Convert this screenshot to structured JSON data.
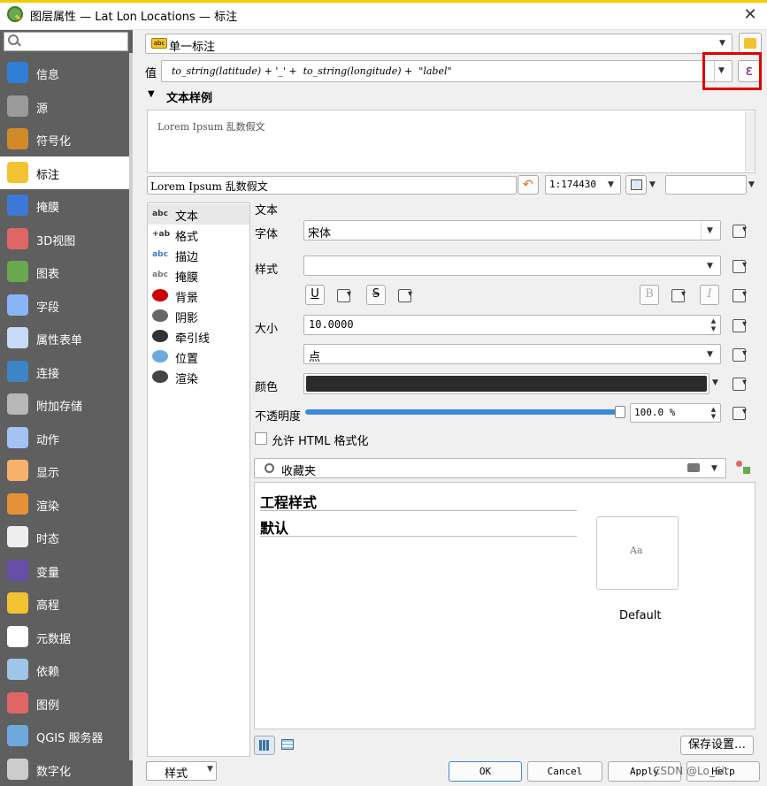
{
  "window": {
    "title": "图层属性 — Lat Lon Locations — 标注",
    "close": "✕"
  },
  "sidebar": {
    "search_placeholder": "",
    "items": [
      {
        "label": "信息",
        "icon": "info-icon",
        "color": "#2f7ed8"
      },
      {
        "label": "源",
        "icon": "source-icon",
        "color": "#9b9b9b"
      },
      {
        "label": "符号化",
        "icon": "symbology-icon",
        "color": "#d08a2a"
      },
      {
        "label": "标注",
        "icon": "labels-icon",
        "color": "#f1c232"
      },
      {
        "label": "掩膜",
        "icon": "mask-icon",
        "color": "#3c78d8"
      },
      {
        "label": "3D视图",
        "icon": "3d-view-icon",
        "color": "#e06666"
      },
      {
        "label": "图表",
        "icon": "diagrams-icon",
        "color": "#6aa84f"
      },
      {
        "label": "字段",
        "icon": "fields-icon",
        "color": "#8ab4f8"
      },
      {
        "label": "属性表单",
        "icon": "attributes-form-icon",
        "color": "#c9daf8"
      },
      {
        "label": "连接",
        "icon": "joins-icon",
        "color": "#3d85c6"
      },
      {
        "label": "附加存储",
        "icon": "auxiliary-storage-icon",
        "color": "#b7b7b7"
      },
      {
        "label": "动作",
        "icon": "actions-icon",
        "color": "#a4c2f4"
      },
      {
        "label": "显示",
        "icon": "display-icon",
        "color": "#f6b26b"
      },
      {
        "label": "渲染",
        "icon": "rendering-icon",
        "color": "#e69138"
      },
      {
        "label": "时态",
        "icon": "temporal-icon",
        "color": "#eeeeee"
      },
      {
        "label": "变量",
        "icon": "variables-icon",
        "color": "#674ea7"
      },
      {
        "label": "高程",
        "icon": "elevation-icon",
        "color": "#f1c232"
      },
      {
        "label": "元数据",
        "icon": "metadata-icon",
        "color": "#ffffff"
      },
      {
        "label": "依赖",
        "icon": "dependencies-icon",
        "color": "#9fc5e8"
      },
      {
        "label": "图例",
        "icon": "legend-icon",
        "color": "#e06666"
      },
      {
        "label": "QGIS 服务器",
        "icon": "qgis-server-icon",
        "color": "#6fa8dc"
      },
      {
        "label": "数字化",
        "icon": "digitizing-icon",
        "color": "#cccccc"
      }
    ],
    "style_button": "样式"
  },
  "labeling_mode": {
    "value": "单一标注",
    "badge": "abc"
  },
  "value_row": {
    "label": "值",
    "expression": "to_string(latitude) + '_' +  to_string(longitude) +  \"label\"",
    "epsilon": "ε"
  },
  "text_sample": {
    "section_title": "文本样例",
    "preview_text": "Lorem Ipsum 乱数假文",
    "input_value": "Lorem Ipsum 乱数假文",
    "scale": "1:174430"
  },
  "subtabs": [
    {
      "label": "文本",
      "icon": "abc"
    },
    {
      "label": "格式",
      "icon": "+ab"
    },
    {
      "label": "描边",
      "icon": "abc"
    },
    {
      "label": "掩膜",
      "icon": "abc"
    },
    {
      "label": "背景",
      "icon": "shield-icon"
    },
    {
      "label": "阴影",
      "icon": "shadow-icon"
    },
    {
      "label": "牵引线",
      "icon": "callout-icon"
    },
    {
      "label": "位置",
      "icon": "placement-icon"
    },
    {
      "label": "渲染",
      "icon": "rendering-icon"
    }
  ],
  "text_panel": {
    "heading": "文本",
    "font_label": "字体",
    "font_value": "宋体",
    "style_label": "样式",
    "style_value": "",
    "underline": "U",
    "strike": "S",
    "bold": "B",
    "italic": "I",
    "size_label": "大小",
    "size_value": "10.0000",
    "unit_value": "点",
    "color_label": "颜色",
    "color_swatch": "#2b2b2b",
    "opacity_label": "不透明度",
    "opacity_value": "100.0 %",
    "opacity_fraction": 1.0,
    "html_checkbox": "允许 HTML 格式化",
    "favorites_search": "收藏夹"
  },
  "style_list": {
    "groups": [
      "工程样式",
      "默认"
    ],
    "symbol_preview": "Aa",
    "symbol_name": "Default",
    "save_button": "保存设置…"
  },
  "footer": {
    "ok": "OK",
    "cancel": "Cancel",
    "apply": "Apply",
    "help": "Help",
    "watermark": "CSDN @Lo_Sir"
  }
}
